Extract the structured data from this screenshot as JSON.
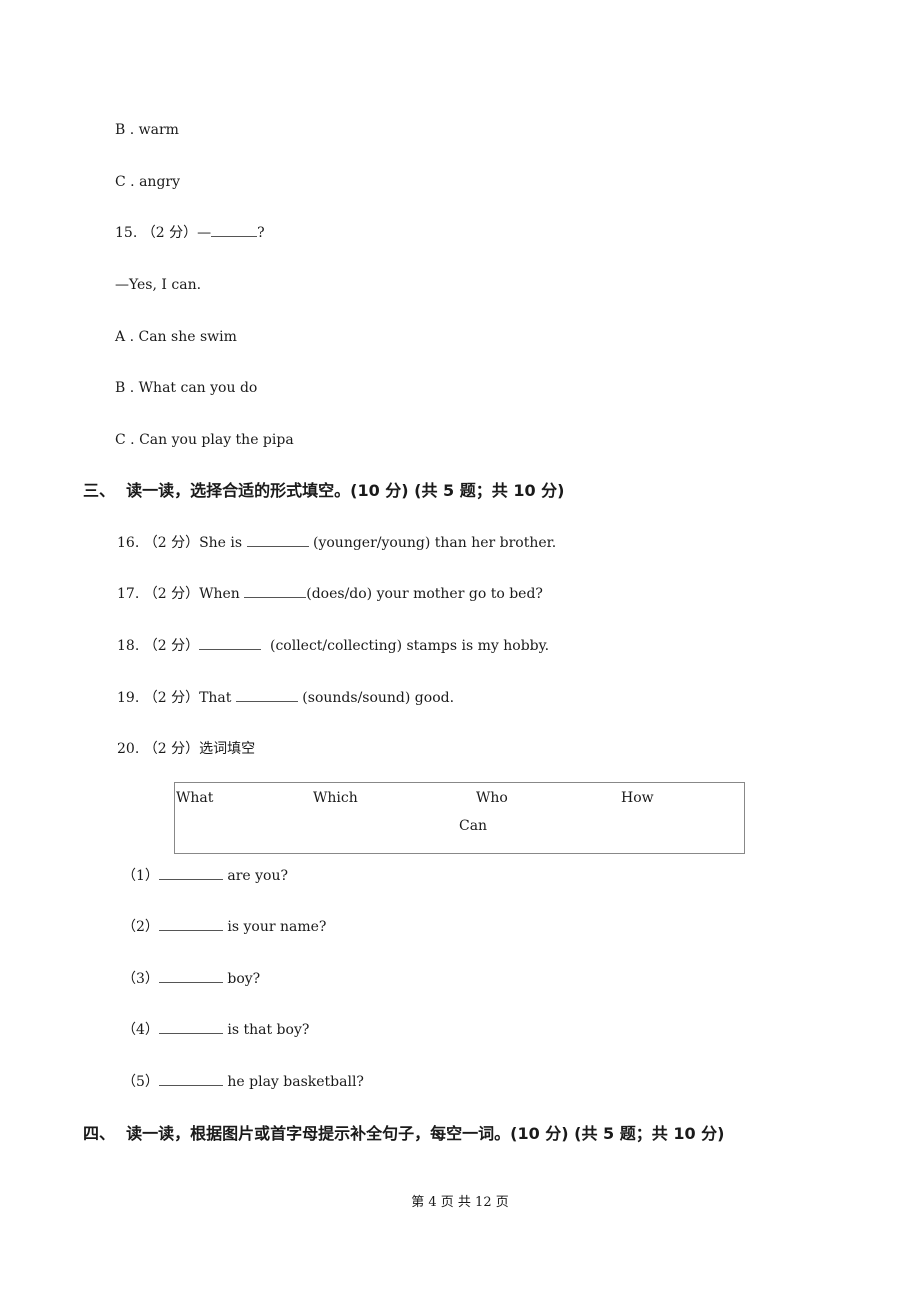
{
  "prev_question": {
    "options": [
      {
        "letter": "B",
        "text": "warm"
      },
      {
        "letter": "C",
        "text": "angry"
      }
    ]
  },
  "q15": {
    "number": "15.",
    "score": "（2 分）",
    "prompt_prefix": "—",
    "prompt_suffix": "?",
    "response": "—Yes, I can.",
    "options": [
      {
        "letter": "A",
        "text": "Can she swim"
      },
      {
        "letter": "B",
        "text": "What can you do"
      },
      {
        "letter": "C",
        "text": "Can you play the pipa"
      }
    ]
  },
  "section3": {
    "title": "三、  读一读，选择合适的形式填空。(10 分) (共 5 题；共 10 分)",
    "questions": [
      {
        "number": "16.",
        "score": "（2 分）",
        "before": "She is ",
        "after": " (younger/young) than her brother."
      },
      {
        "number": "17.",
        "score": "（2 分）",
        "before": "When ",
        "after": "(does/do) your mother go to bed?"
      },
      {
        "number": "18.",
        "score": "（2 分）",
        "before": "",
        "after": "  (collect/collecting) stamps is my hobby."
      },
      {
        "number": "19.",
        "score": "（2 分）",
        "before": "That ",
        "after": " (sounds/sound) good."
      }
    ],
    "q20": {
      "number": "20.",
      "score": "（2 分）",
      "instruction": "选词填空",
      "word_bank": [
        "What",
        "Which",
        "Who",
        "How",
        "Can"
      ],
      "items": [
        {
          "label": "（1）",
          "after": " are you?"
        },
        {
          "label": "（2）",
          "after": " is your name?"
        },
        {
          "label": "（3）",
          "after": " boy?"
        },
        {
          "label": "（4）",
          "after": " is that boy?"
        },
        {
          "label": "（5）",
          "after": " he play basketball?"
        }
      ]
    }
  },
  "section4": {
    "title": "四、  读一读，根据图片或首字母提示补全句子，每空一词。(10 分) (共 5 题；共 10 分)"
  },
  "footer": {
    "page_text": "第 4 页 共 12 页"
  }
}
